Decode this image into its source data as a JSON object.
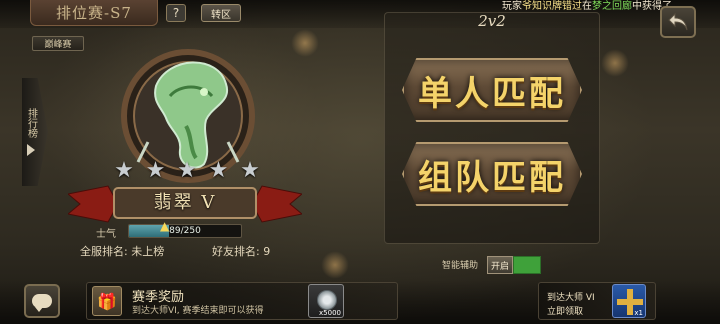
{
  "topbar": {
    "season_title": "排位赛-S7",
    "help_label": "?",
    "transfer_label": "转区",
    "ticker": {
      "prefix": "玩家",
      "player": "爷知识牌错过",
      "mid": "在",
      "location": "梦之回廊",
      "suffix": "中获得了"
    }
  },
  "left": {
    "peak_label": "巅峰赛",
    "rank_tab_label": "排行榜",
    "stars": [
      "★",
      "★",
      "★",
      "★",
      "★"
    ],
    "rank_name": "翡翠 V",
    "morale": {
      "label": "士气",
      "current": 89,
      "max": 250,
      "text": "89/250",
      "fraction": 0.356
    },
    "server_rank": "全服排名: 未上榜",
    "friend_rank": "好友排名: 9"
  },
  "match": {
    "mode": "2v2",
    "solo_label": "单人匹配",
    "team_label": "组队匹配",
    "assist_label": "智能辅助",
    "assist_state": "开启"
  },
  "bottom": {
    "reward_title": "赛季奖励",
    "reward_desc": "到达大师VI, 赛季结束即可以获得",
    "reward_qty": "x5000",
    "master_title": "到达大师 VI",
    "master_claim": "立即领取",
    "master_qty": "x1"
  },
  "icons": {
    "back": "back-arrow-icon",
    "chat": "chat-bubble-icon",
    "gift": "gift-icon",
    "dragon": "jade-dragon-emblem"
  },
  "colors": {
    "gold_text": "#f4d36a",
    "assist_on": "#3fa13a",
    "morale_fill": "#3f8a94"
  }
}
